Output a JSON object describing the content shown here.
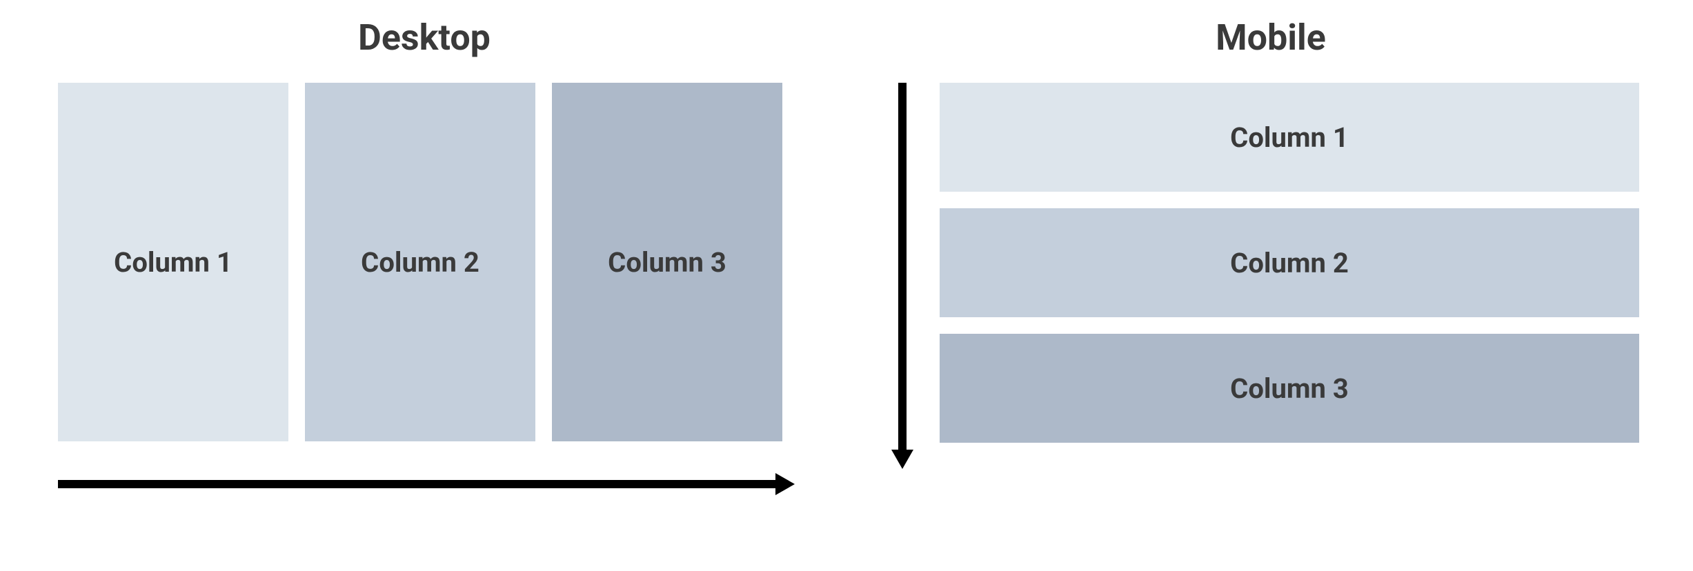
{
  "desktop": {
    "heading": "Desktop",
    "columns": [
      {
        "label": "Column 1",
        "color": "#dde5ec"
      },
      {
        "label": "Column 2",
        "color": "#c4cfdc"
      },
      {
        "label": "Column 3",
        "color": "#adb9c9"
      }
    ],
    "flow": "horizontal"
  },
  "mobile": {
    "heading": "Mobile",
    "columns": [
      {
        "label": "Column 1",
        "color": "#dde5ec"
      },
      {
        "label": "Column 2",
        "color": "#c4cfdc"
      },
      {
        "label": "Column 3",
        "color": "#adb9c9"
      }
    ],
    "flow": "vertical"
  }
}
